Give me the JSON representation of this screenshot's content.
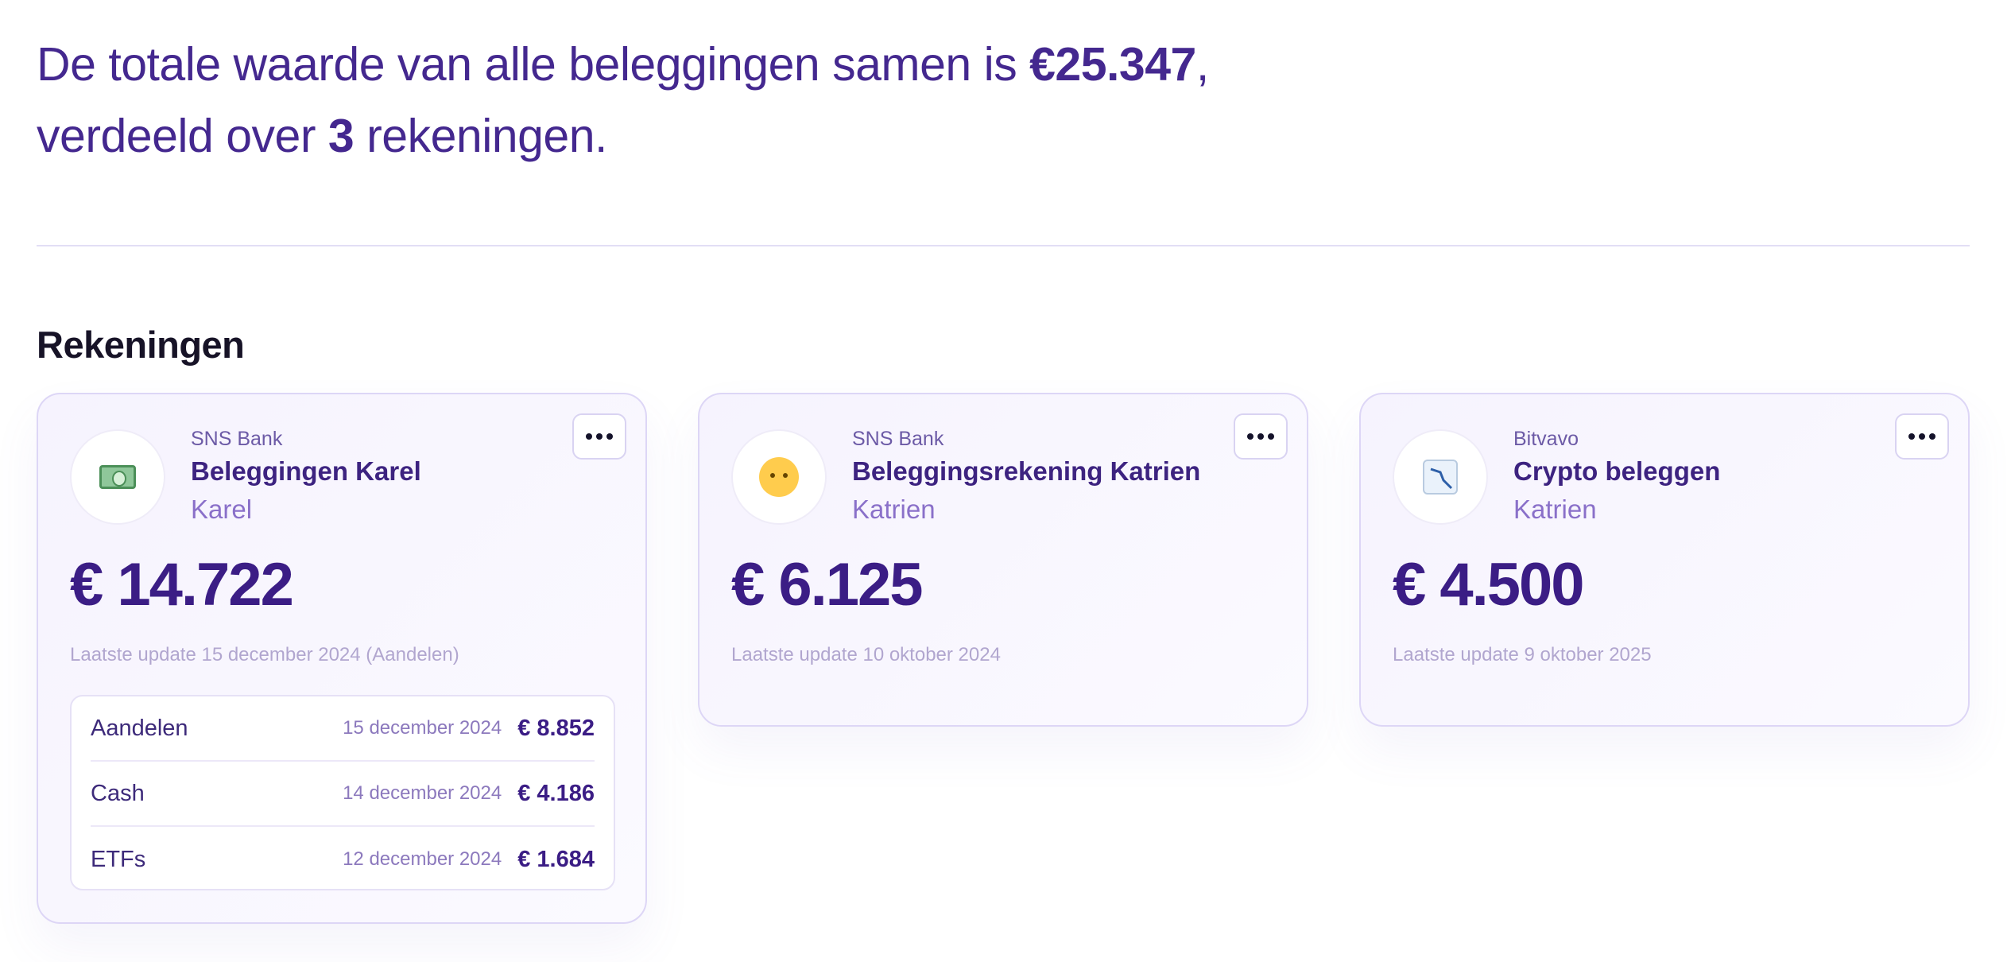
{
  "summary": {
    "line1_prefix": "De totale waarde van alle beleggingen samen is ",
    "total": "€25.347",
    "line1_suffix": ",",
    "line2_prefix": "verdeeld over ",
    "count": "3",
    "line2_suffix": " rekeningen."
  },
  "section_title": "Rekeningen",
  "accounts": [
    {
      "icon": "banknote-icon",
      "bank": "SNS Bank",
      "name": "Beleggingen Karel",
      "owner": "Karel",
      "amount": "€ 14.722",
      "updated": "Laatste update 15 december 2024 (Aandelen)",
      "positions": [
        {
          "label": "Aandelen",
          "date": "15 december 2024",
          "value": "€ 8.852"
        },
        {
          "label": "Cash",
          "date": "14 december 2024",
          "value": "€ 4.186"
        },
        {
          "label": "ETFs",
          "date": "12 december 2024",
          "value": "€ 1.684"
        }
      ]
    },
    {
      "icon": "baby-icon",
      "bank": "SNS Bank",
      "name": "Beleggingsrekening Katrien",
      "owner": "Katrien",
      "amount": "€ 6.125",
      "updated": "Laatste update 10 oktober 2024"
    },
    {
      "icon": "chart-decreasing-icon",
      "bank": "Bitvavo",
      "name": "Crypto beleggen",
      "owner": "Katrien",
      "amount": "€ 4.500",
      "updated": "Laatste update 9 oktober 2025"
    }
  ]
}
